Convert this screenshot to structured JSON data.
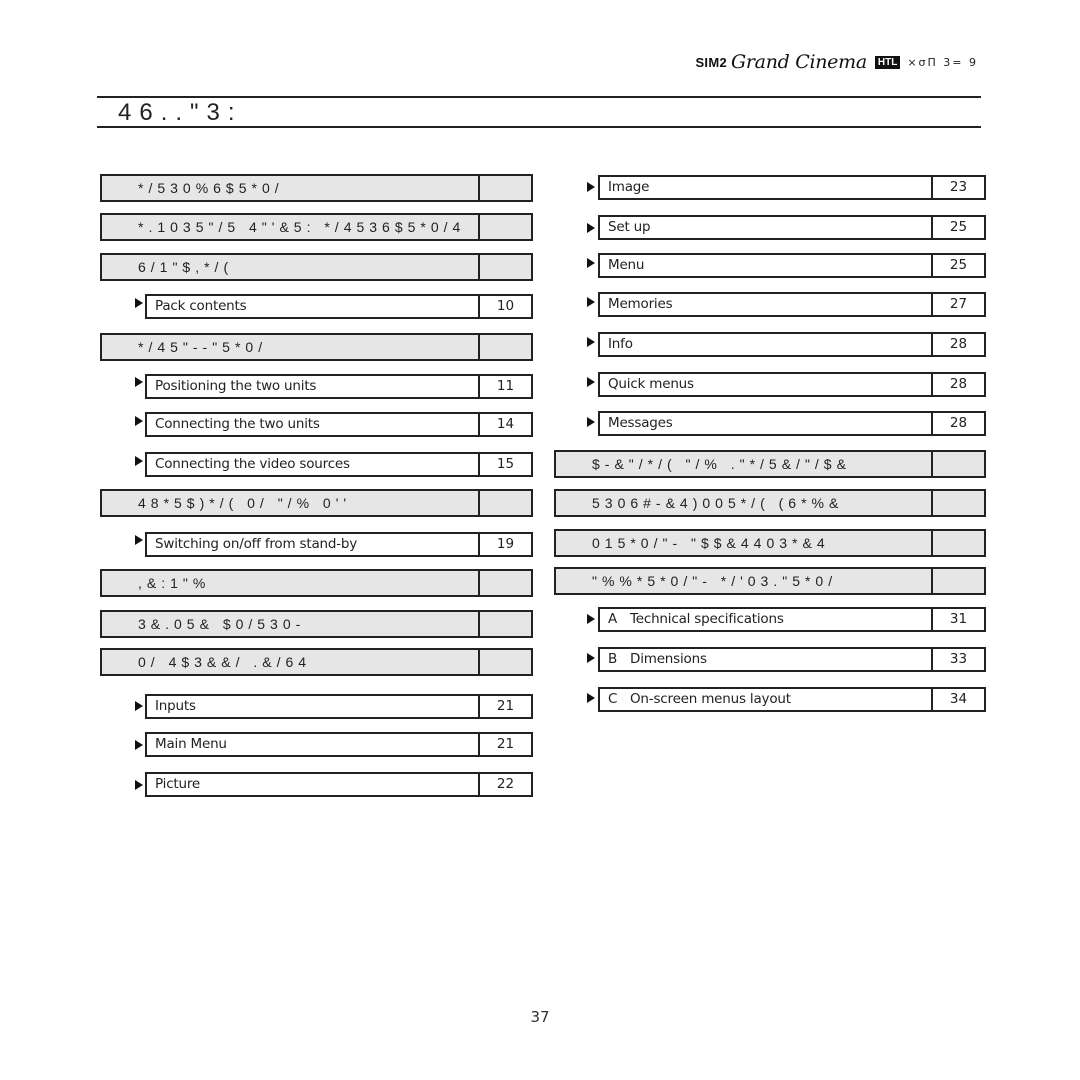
{
  "header": {
    "brand_sim2": "SIM2",
    "brand_script": "Grand Cinema",
    "brand_badge": "HTL",
    "brand_model": "×σΠ 3= 9"
  },
  "title": "46..\"3:",
  "left_column": [
    {
      "type": "section",
      "label": "*/530%6$5*0/",
      "page": ""
    },
    {
      "type": "section",
      "label": "*.1035\"/5 4\"'&5: */4536$5*0/4",
      "page": ""
    },
    {
      "type": "section",
      "label": "6/1\"$,*/(",
      "page": ""
    },
    {
      "type": "item",
      "label": "Pack contents",
      "page": "10"
    },
    {
      "type": "section",
      "label": "*/45\"--\"5*0/",
      "page": ""
    },
    {
      "type": "item",
      "label": "Positioning the two units",
      "page": "11"
    },
    {
      "type": "item",
      "label": "Connecting the two units",
      "page": "14"
    },
    {
      "type": "item",
      "label": "Connecting the video sources",
      "page": "15"
    },
    {
      "type": "section",
      "label": "48*5$)*/( 0/ \"/% 0''",
      "page": ""
    },
    {
      "type": "item",
      "label": "Switching on/off from stand-by",
      "page": "19"
    },
    {
      "type": "section",
      "label": ",&:1\"%",
      "page": ""
    },
    {
      "type": "section",
      "label": "3&.05& $0/530-",
      "page": ""
    },
    {
      "type": "section",
      "label": "0/ 4$3&&/ .&/64",
      "page": ""
    },
    {
      "type": "item",
      "label": "Inputs",
      "page": "21"
    },
    {
      "type": "item",
      "label": "Main Menu",
      "page": "21"
    },
    {
      "type": "item",
      "label": "Picture",
      "page": "22"
    }
  ],
  "right_column": [
    {
      "type": "item",
      "label": "Image",
      "page": "23"
    },
    {
      "type": "item",
      "label": "Set up",
      "page": "25"
    },
    {
      "type": "item",
      "label": "Menu",
      "page": "25"
    },
    {
      "type": "item",
      "label": "Memories",
      "page": "27"
    },
    {
      "type": "item",
      "label": "Info",
      "page": "28"
    },
    {
      "type": "item",
      "label": "Quick menus",
      "page": "28"
    },
    {
      "type": "item",
      "label": "Messages",
      "page": "28"
    },
    {
      "type": "section",
      "label": "$-&\"/*/( \"/% .\"*/5&/\"/$&",
      "page": ""
    },
    {
      "type": "section",
      "label": "5306#-&4)005*/( (6*%&",
      "page": ""
    },
    {
      "type": "section",
      "label": "015*0/\"- \"$$&4403*&4",
      "page": ""
    },
    {
      "type": "section",
      "label": "\"%%*5*0/\"- */'03.\"5*0/",
      "page": ""
    },
    {
      "type": "item",
      "letter": "A",
      "label": "Technical specifications",
      "page": "31"
    },
    {
      "type": "item",
      "letter": "B",
      "label": "Dimensions",
      "page": "33"
    },
    {
      "type": "item",
      "letter": "C",
      "label": "On-screen menus layout",
      "page": "34"
    }
  ],
  "footer": {
    "page_number": "37"
  }
}
